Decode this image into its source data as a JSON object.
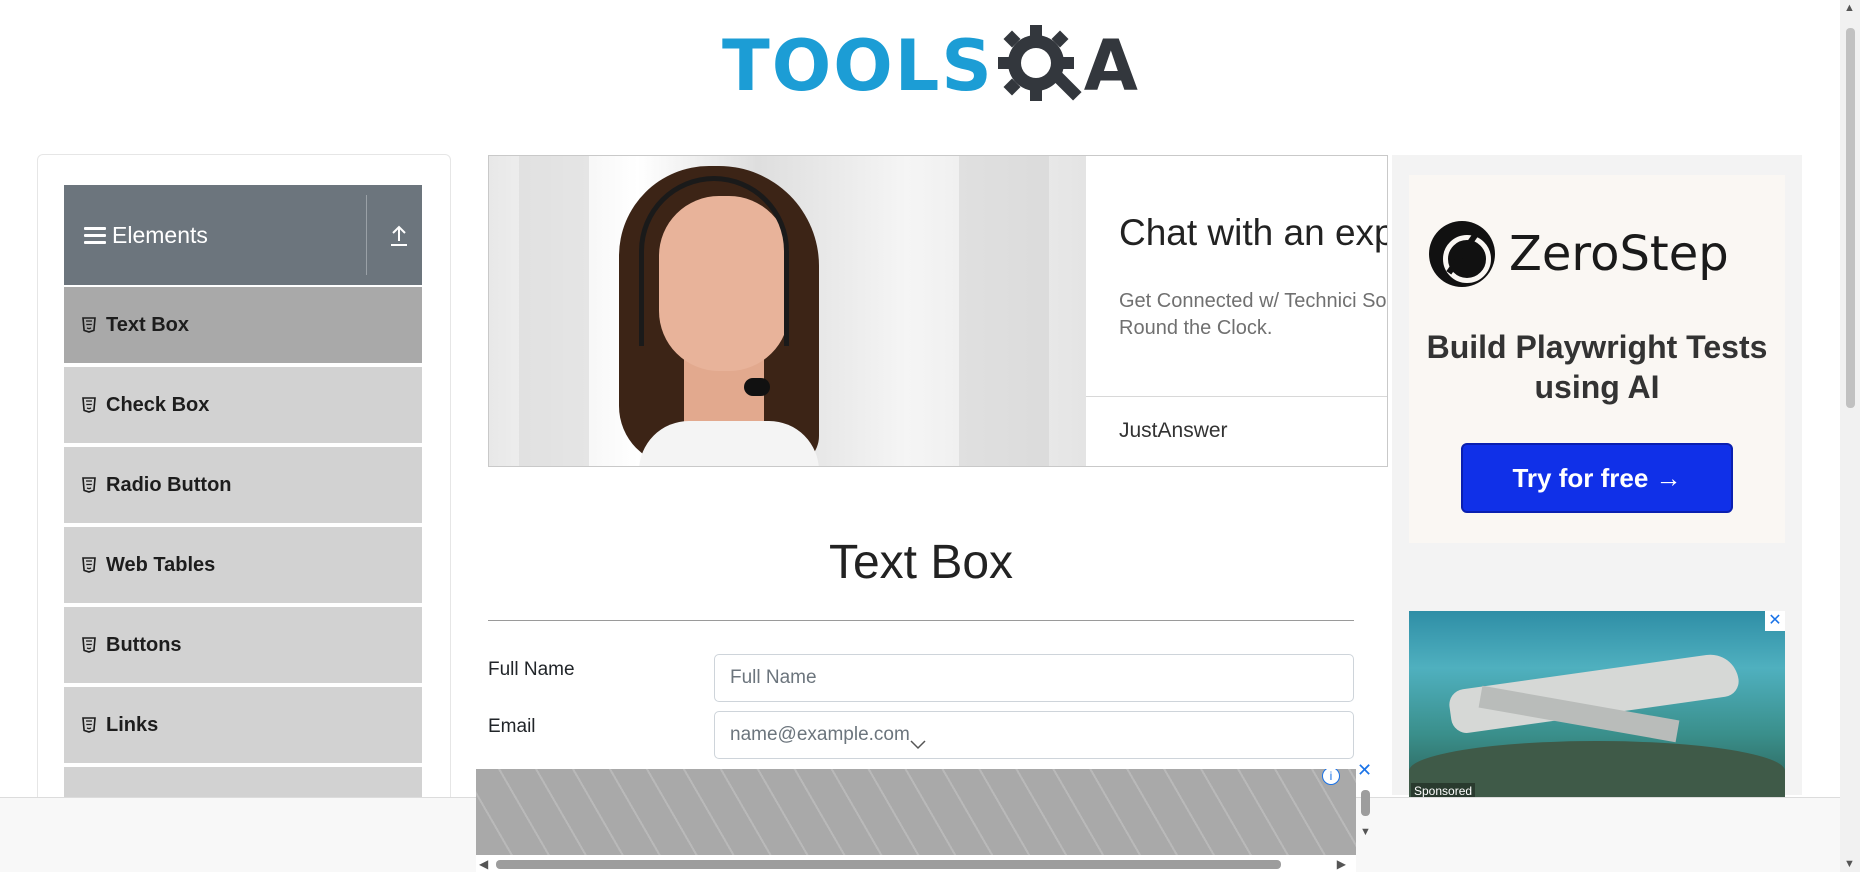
{
  "logo": {
    "text_tools": "TOOLS",
    "text_qa": "A",
    "colors": {
      "tools": "#1c9dd5",
      "qa": "#33373d"
    }
  },
  "sidebar": {
    "group_title": "Elements",
    "items": [
      {
        "label": "Text Box",
        "active": true
      },
      {
        "label": "Check Box"
      },
      {
        "label": "Radio Button"
      },
      {
        "label": "Web Tables"
      },
      {
        "label": "Buttons"
      },
      {
        "label": "Links"
      }
    ]
  },
  "banner_ad": {
    "headline": "Chat with an exp",
    "subtext": "Get Connected w/ Technici Solution Round the Clock.",
    "brand": "JustAnswer"
  },
  "right_ad": {
    "brand": "ZeroStep",
    "tagline": "Build Playwright Tests using AI",
    "cta": "Try for free →",
    "sponsored": "Sponsored",
    "close": "✕",
    "accent": "#1030e8"
  },
  "main": {
    "title": "Text Box",
    "fields": {
      "full_name": {
        "label": "Full Name",
        "placeholder": "Full Name",
        "value": ""
      },
      "email": {
        "label": "Email",
        "placeholder": "name@example.com",
        "value": ""
      }
    }
  },
  "bottom_ad": {
    "close": "✕",
    "info": "i"
  }
}
